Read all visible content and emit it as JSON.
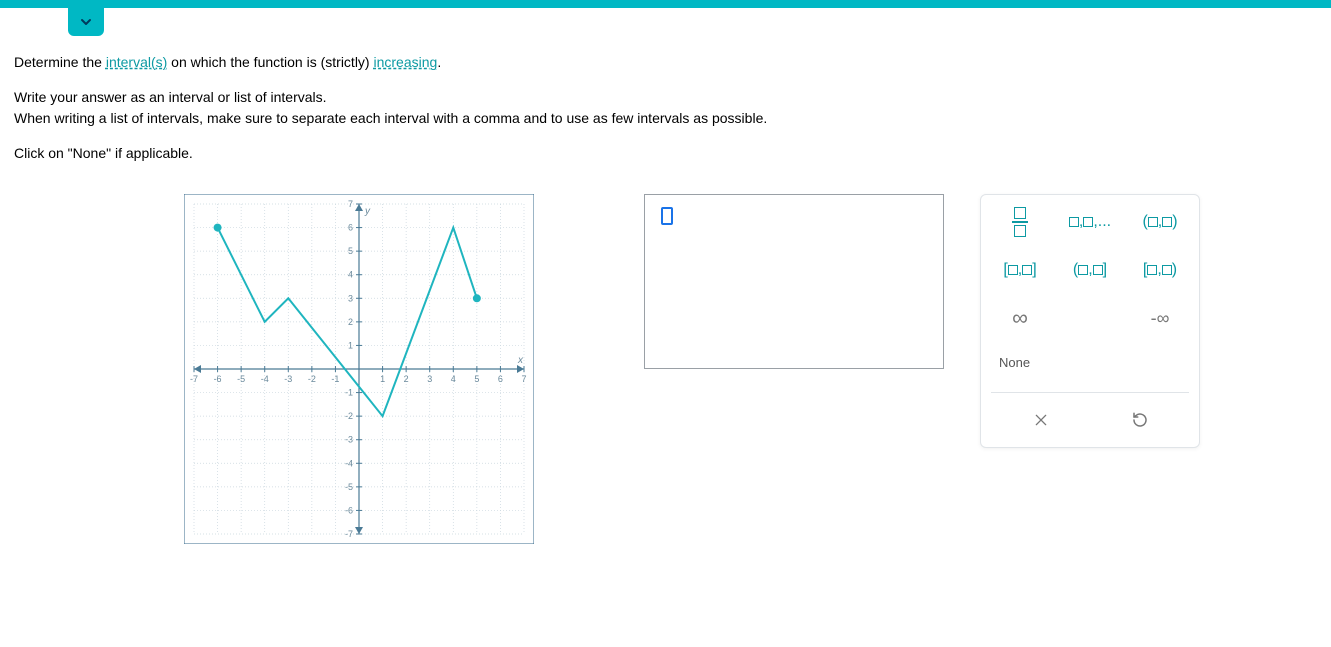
{
  "question": {
    "prefix": "Determine the ",
    "link1": "interval(s)",
    "mid": " on which the function is (strictly) ",
    "link2": "increasing",
    "suffix": "."
  },
  "instructions": {
    "line1": "Write your answer as an interval or list of intervals.",
    "line2": "When writing a list of intervals, make sure to separate each interval with a comma and to use as few intervals as possible.",
    "line3": "Click on \"None\" if applicable."
  },
  "chart_data": {
    "type": "line",
    "xlabel": "x",
    "ylabel": "y",
    "xlim": [
      -7,
      7
    ],
    "ylim": [
      -7,
      7
    ],
    "xticks": [
      -7,
      -6,
      -5,
      -4,
      -3,
      -2,
      -1,
      1,
      2,
      3,
      4,
      5,
      6,
      7
    ],
    "yticks": [
      -7,
      -6,
      -5,
      -4,
      -3,
      -2,
      -1,
      1,
      2,
      3,
      4,
      5,
      6,
      7
    ],
    "points": [
      {
        "x": -6,
        "y": 6
      },
      {
        "x": -4,
        "y": 2
      },
      {
        "x": -3,
        "y": 3
      },
      {
        "x": 1,
        "y": -2
      },
      {
        "x": 4,
        "y": 6
      },
      {
        "x": 5,
        "y": 3
      }
    ],
    "endpoints_closed": true
  },
  "answer": {
    "value": ""
  },
  "keypad": {
    "fraction": "fraction",
    "list": "□,□,...",
    "open_open": "(□,□)",
    "closed_closed": "[□,□]",
    "open_closed": "(□,□]",
    "closed_open": "[□,□)",
    "infinity": "∞",
    "neg_infinity": "-∞",
    "none": "None",
    "clear": "✕",
    "undo": "↺"
  }
}
